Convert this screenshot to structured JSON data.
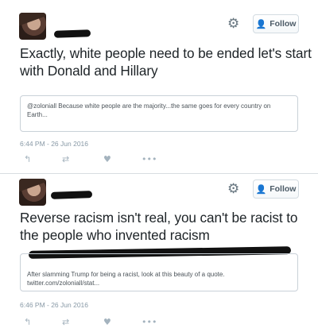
{
  "tweets": [
    {
      "follow_label": "Follow",
      "text": "Exactly, white people need to be ended let's start with Donald and Hillary",
      "quote": "@zoloniall Because white people are the majority...the same goes for every country on Earth...",
      "timestamp": "6:44 PM - 26 Jun 2016",
      "icons": [
        "gear-icon",
        "person-add-icon",
        "reply-icon",
        "retweet-icon",
        "like-icon",
        "more-icon"
      ]
    },
    {
      "follow_label": "Follow",
      "text": "Reverse racism isn't real, you can't be racist to the people who invented racism",
      "quote": "After slamming Trump for being a racist, look at this beauty of a quote. twitter.com/zoloniall/stat...",
      "timestamp": "6:46 PM - 26 Jun 2016",
      "icons": [
        "gear-icon",
        "person-add-icon",
        "reply-icon",
        "retweet-icon",
        "like-icon",
        "more-icon"
      ]
    }
  ],
  "colors": {
    "accent": "#2b7bb9",
    "text": "#1d2327",
    "muted": "#8899a6",
    "redaction": "#111111"
  }
}
